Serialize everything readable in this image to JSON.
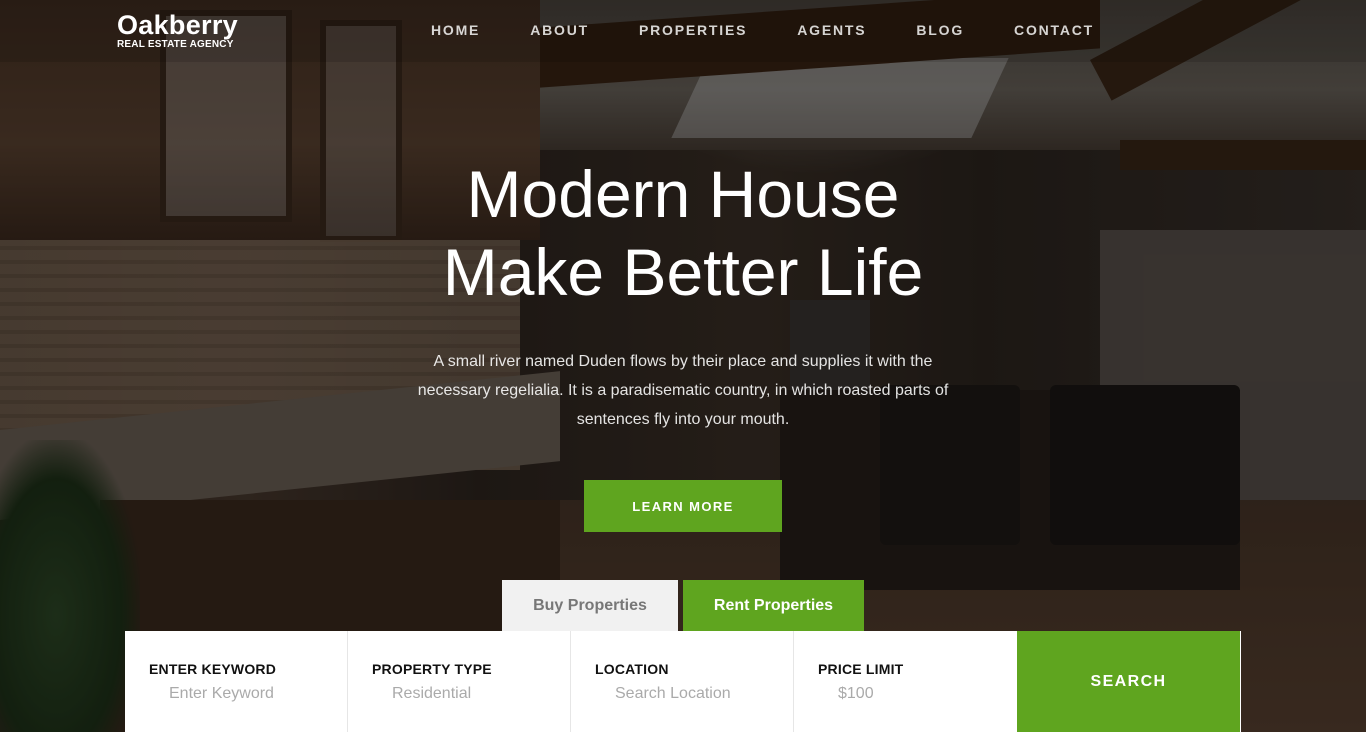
{
  "brand": {
    "name": "Oakberry",
    "tagline": "REAL ESTATE AGENCY"
  },
  "nav": {
    "items": [
      "HOME",
      "ABOUT",
      "PROPERTIES",
      "AGENTS",
      "BLOG",
      "CONTACT"
    ]
  },
  "hero": {
    "title_line1": "Modern House",
    "title_line2": "Make Better Life",
    "description": "A small river named Duden flows by their place and supplies it with the necessary regelialia. It is a paradisematic country, in which roasted parts of sentences fly into your mouth.",
    "cta_label": "LEARN MORE"
  },
  "tabs": {
    "buy": "Buy Properties",
    "rent": "Rent Properties",
    "active": "rent"
  },
  "search": {
    "keyword": {
      "label": "ENTER KEYWORD",
      "placeholder": "Enter Keyword"
    },
    "property_type": {
      "label": "PROPERTY TYPE",
      "value": "Residential"
    },
    "location": {
      "label": "LOCATION",
      "placeholder": "Search Location"
    },
    "price_limit": {
      "label": "PRICE LIMIT",
      "value": "$100"
    },
    "button_label": "SEARCH"
  },
  "colors": {
    "accent": "#5fa51f",
    "tab_inactive_bg": "#f1f1f1",
    "text_dark": "#111111"
  }
}
